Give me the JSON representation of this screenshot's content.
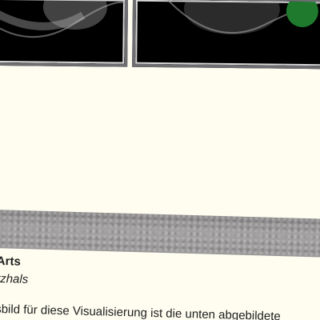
{
  "thumbnails": [
    {
      "name": "left-thumbnail"
    },
    {
      "name": "right-thumbnail",
      "accent_color": "#1f7a2e"
    }
  ],
  "frame_color": "#6e6e72",
  "page_background": "#fefdf0",
  "entry": {
    "title": "Arts",
    "author": "rzhals",
    "description": "sbild für diese Visualisierung ist die unten abgebildete"
  }
}
